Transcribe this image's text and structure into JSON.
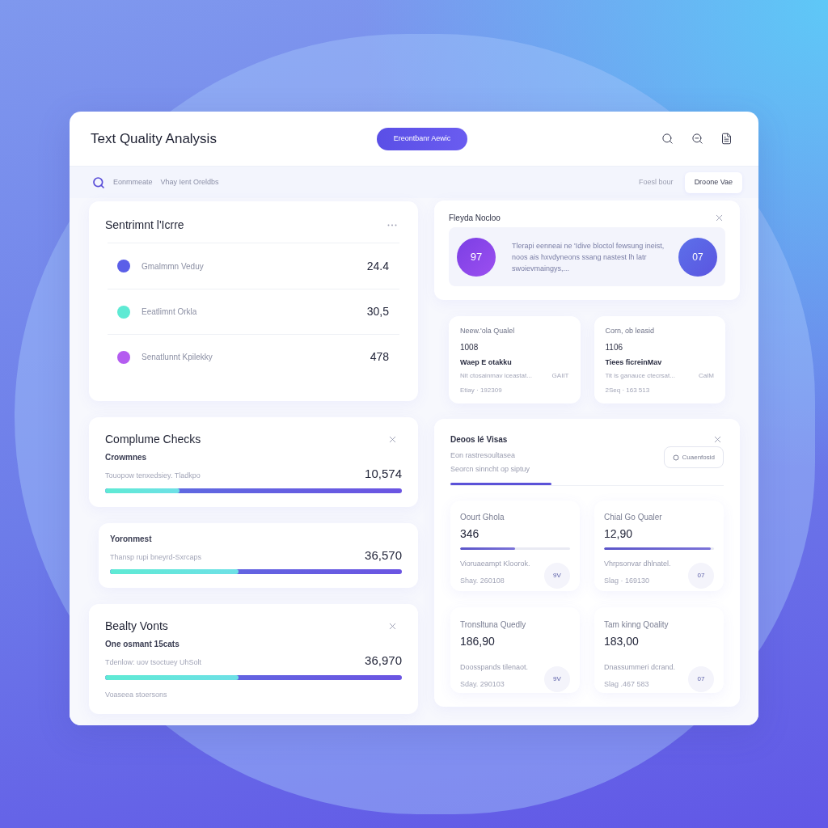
{
  "window": {
    "title": "Text Quality Analysis",
    "action_button": "Ereontbanr Aewic"
  },
  "toolbar": {
    "breadcrumb": [
      "Eonmmeate",
      "Vhay Ient Oreldbs"
    ],
    "link": "Foesl bour",
    "button": "Droone Vae"
  },
  "sentiment": {
    "title": "Sentrimnt l'Icrre",
    "rows": [
      {
        "label": "Gmalmmn Veduy",
        "value": "24.4",
        "color": "#5b5fe8"
      },
      {
        "label": "Eeatlimnt Orkla",
        "value": "30,5",
        "color": "#5eead4"
      },
      {
        "label": "Senatlunnt Kpilekky",
        "value": "478",
        "color": "#b45cf0"
      }
    ]
  },
  "compliance": [
    {
      "title": "Complume Checks",
      "subtitle": "Crowmnes",
      "description": "Touopow tenxedsiey. Tladkpo",
      "value": "10,574",
      "level": 0.25
    },
    {
      "subtitle": "Yoronmest",
      "description": "Thansp rupi bneyrd-Sxrcaps",
      "value": "36,570",
      "level": 0.44
    },
    {
      "title": "Bealty Vonts",
      "subtitle": "One osmant 15cats",
      "description": "Tdenlow: uov tsoctuey UhSolt",
      "value": "36,970",
      "level": 0.45,
      "note": "Voaseea stoersons"
    }
  ],
  "notice": {
    "title": "Fleyda Nocloo",
    "left_score": "97",
    "text": "Tlerapi eenneai ne 'Idive bloctol fewsung ineist, noos ais hxvdyneons ssang nastest lh latr swoievmaingys,...",
    "right_score": "07"
  },
  "stats": [
    {
      "label": "Neew.'ola Qualel",
      "value": "1008",
      "heading": "Waep E otakku",
      "description": "Nit ctosainmav iceastat...",
      "tag": "GAIIT",
      "footer": "Etiay · 192309"
    },
    {
      "label": "Corn, ob leasid",
      "value": "1106",
      "heading": "Tiees ficreinMav",
      "description": "Tit is ganauce ctecrsat...",
      "tag": "CaIM",
      "footer": "2Seq · 163 513"
    }
  ],
  "details": {
    "title": "Deoos lé Visas",
    "lines": [
      "Eon rastresoultasea",
      "Seorcn sinncht op siptuy"
    ],
    "button": "Cuaenfosid",
    "metrics": [
      {
        "label": "Oourt Ghola",
        "value": "346",
        "level": 0.5,
        "description": "Vioruaeampt Kloorok.",
        "footer": "Shay. 260108",
        "badge": "9V"
      },
      {
        "label": "Chial Go Qualer",
        "value": "12,90",
        "level": 0.97,
        "description": "Vhrpsonvar dhlnatel.",
        "footer": "Slag · 169130",
        "badge": "07"
      },
      {
        "label": "Tronsltuna Quedly",
        "value": "186,90",
        "description": "Doosspands tilenaot.",
        "footer": "Sday. 290103",
        "badge": "9V"
      },
      {
        "label": "Tam kinng Qoality",
        "value": "183,00",
        "description": "Dnassummeri dcrand.",
        "footer": "Slag .467 583",
        "badge": "07"
      }
    ]
  }
}
